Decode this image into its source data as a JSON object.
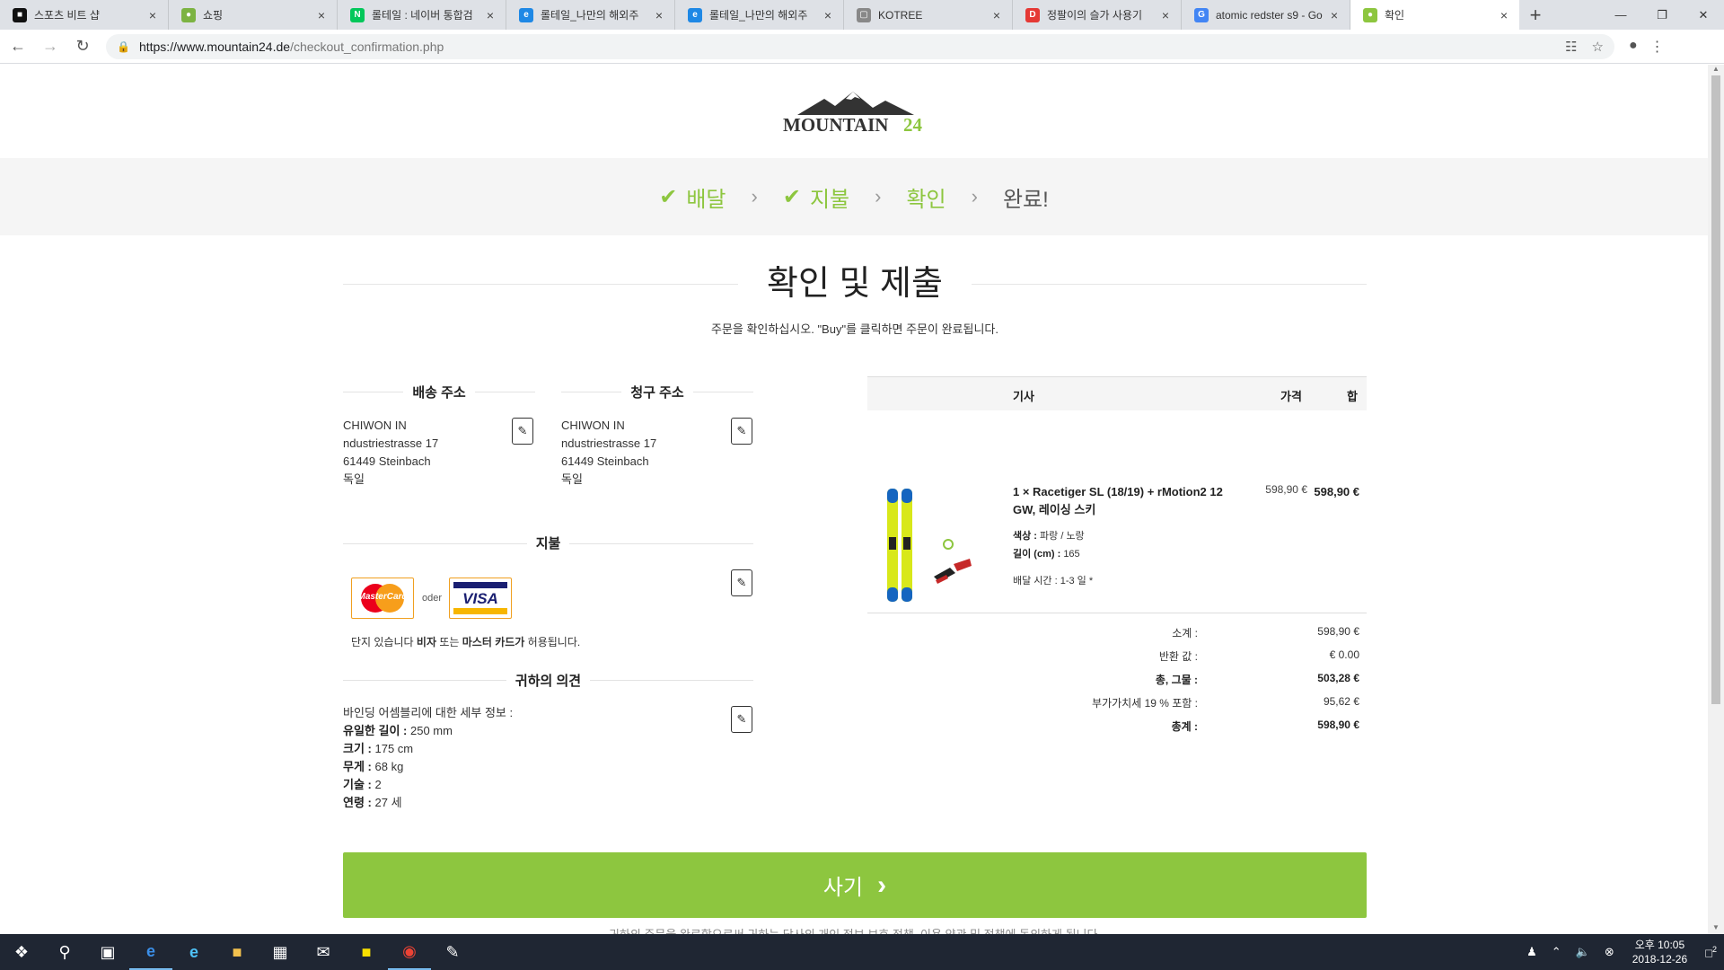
{
  "browser": {
    "tabs": [
      {
        "label": "스포츠 비트 샵",
        "fav_color": "#111",
        "fav_glyph": "■"
      },
      {
        "label": "쇼핑",
        "fav_color": "#7cb342",
        "fav_glyph": "●"
      },
      {
        "label": "롤테일 : 네이버 통합검",
        "fav_color": "#03c75a",
        "fav_glyph": "N"
      },
      {
        "label": "롤테일_나만의 해외주",
        "fav_color": "#1e88e5",
        "fav_glyph": "e"
      },
      {
        "label": "롤테일_나만의 해외주",
        "fav_color": "#1e88e5",
        "fav_glyph": "e"
      },
      {
        "label": "KOTREE",
        "fav_color": "#888",
        "fav_glyph": "▢"
      },
      {
        "label": "정팔이의 슬가 사용기",
        "fav_color": "#e53935",
        "fav_glyph": "D"
      },
      {
        "label": "atomic redster s9 - Go",
        "fav_color": "#4285f4",
        "fav_glyph": "G"
      },
      {
        "label": "확인",
        "fav_color": "#8dc63f",
        "fav_glyph": "●"
      }
    ],
    "url_host": "https://www.mountain24.de",
    "url_path": "/checkout_confirmation.php"
  },
  "logo": {
    "text1": "MOUNTAIN",
    "text2": "24"
  },
  "steps": [
    {
      "label": "배달"
    },
    {
      "label": "지불"
    },
    {
      "label": "확인"
    },
    {
      "label": "완료!"
    }
  ],
  "page_title": "확인 및 제출",
  "subtitle": "주문을 확인하십시오. \"Buy\"를 클릭하면 주문이 완료됩니다.",
  "shipping": {
    "heading": "배송 주소",
    "lines": [
      "CHIWON IN",
      "ndustriestrasse 17",
      "61449 Steinbach",
      "독일"
    ]
  },
  "billing": {
    "heading": "청구 주소",
    "lines": [
      "CHIWON IN",
      "ndustriestrasse 17",
      "61449 Steinbach",
      "독일"
    ]
  },
  "payment": {
    "heading": "지불",
    "mastercard": "MasterCard",
    "or": "oder",
    "visa": "VISA",
    "note_pre": "단지 있습니다 ",
    "note_b1": "비자",
    "note_mid": " 또는 ",
    "note_b2": "마스터 카드가",
    "note_post": " 허용됩니다."
  },
  "opinion": {
    "heading": "귀하의 의견",
    "intro": "바인딩 어셈블리에 대한 세부 정보 :",
    "rows": [
      {
        "k": "유일한 길이 :",
        "v": "250 mm"
      },
      {
        "k": "크기 :",
        "v": "175 cm"
      },
      {
        "k": "무게 :",
        "v": "68 kg"
      },
      {
        "k": "기술 :",
        "v": "2"
      },
      {
        "k": "연령 :",
        "v": "27 세"
      }
    ]
  },
  "order": {
    "col_article": "기사",
    "col_price": "가격",
    "col_sum": "합",
    "product_name": "1 × Racetiger SL (18/19) + rMotion2 12 GW, 레이싱 스키",
    "price": "598,90 €",
    "total": "598,90 €",
    "color_label": "색상 :",
    "color_value": "파랑 / 노랑",
    "length_label": "길이 (cm) :",
    "length_value": "165",
    "delivery": "배달 시간 : 1-3 일 *",
    "summary": [
      {
        "label": "소계 :",
        "value": "598,90 €",
        "bold": false
      },
      {
        "label": "반환 값 :",
        "value": "€ 0.00",
        "bold": false
      },
      {
        "label": "총, 그물 :",
        "value": "503,28 €",
        "bold": true
      },
      {
        "label": "부가가치세 19 % 포함 :",
        "value": "95,62 €",
        "bold": false
      },
      {
        "label": "총계 :",
        "value": "598,90 €",
        "bold": true
      }
    ]
  },
  "buy_button": "사기",
  "legal_text": "귀하의 주문을 완료함으로써 귀하는 당사의 개인 정보 보호 정책, 이용 약관 및 정책에 동의하게 됩니다.",
  "taskbar": {
    "time": "오후 10:05",
    "date": "2018-12-26",
    "notif_count": "2"
  }
}
